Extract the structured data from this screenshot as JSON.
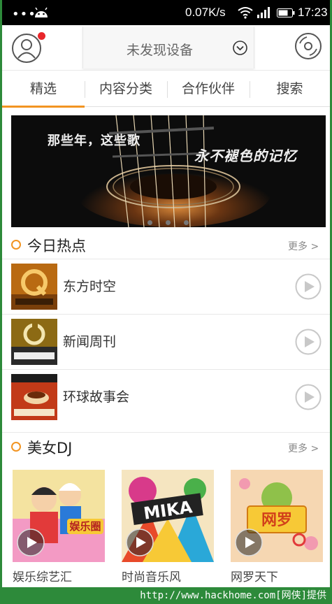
{
  "status_bar": {
    "dots": "•••",
    "speed": "0.07K/s",
    "time": "17:23"
  },
  "header": {
    "device_label": "未发现设备",
    "notification_color": "#e8262a"
  },
  "tabs": [
    {
      "label": "精选",
      "active": true
    },
    {
      "label": "内容分类",
      "active": false
    },
    {
      "label": "合作伙伴",
      "active": false
    },
    {
      "label": "搜索",
      "active": false
    }
  ],
  "banner": {
    "line1": "那些年，这些歌",
    "line2": "永不褪色的记忆",
    "page_count": 3
  },
  "hot": {
    "title": "今日热点",
    "more": "更多 >",
    "items": [
      {
        "name": "东方时空",
        "icon": "dongfang-shikong-thumbnail"
      },
      {
        "name": "新闻周刊",
        "icon": "xinwen-zhoukan-thumbnail"
      },
      {
        "name": "环球故事会",
        "icon": "huanqiu-gushihui-thumbnail"
      }
    ]
  },
  "dj": {
    "title": "美女DJ",
    "more": "更多 >",
    "cards": [
      {
        "caption": "娱乐综艺汇",
        "overlay": "娱乐圈"
      },
      {
        "caption": "时尚音乐风",
        "overlay": "MIKA"
      },
      {
        "caption": "网罗天下",
        "overlay": "网罗"
      }
    ]
  },
  "watermark": "http://www.hackhome.com[网侠]提供",
  "accent_color": "#f29421"
}
